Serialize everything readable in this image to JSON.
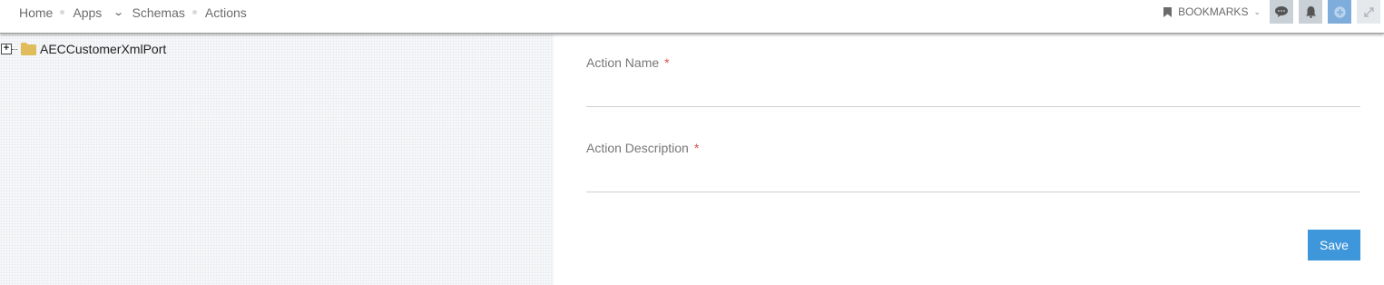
{
  "nav": {
    "items": [
      {
        "label": "Home"
      },
      {
        "label": "Apps"
      },
      {
        "label": "Schemas"
      },
      {
        "label": "Actions"
      }
    ]
  },
  "toolbar": {
    "bookmarks_label": "BOOKMARKS",
    "icons": [
      "chat-icon",
      "bell-icon",
      "plus-circle-icon",
      "expand-icon"
    ]
  },
  "tree": {
    "root_label": "AECCustomerXmlPort"
  },
  "form": {
    "action_name_label": "Action Name",
    "action_name_value": "",
    "action_description_label": "Action Description",
    "action_description_value": "",
    "required_marker": "*",
    "save_label": "Save"
  },
  "colors": {
    "accent": "#3e96db",
    "required": "#d9534f",
    "tool_button": "#c9d0d6",
    "tool_button_active": "#7faddb"
  }
}
